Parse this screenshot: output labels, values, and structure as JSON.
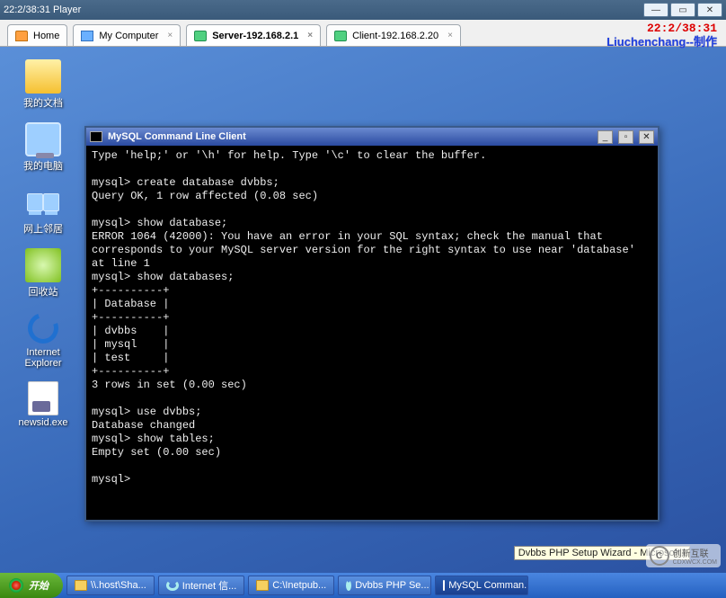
{
  "player": {
    "title": "22:2/38:31 Player"
  },
  "browser_tabs": {
    "items": [
      {
        "label": "Home"
      },
      {
        "label": "My Computer"
      },
      {
        "label": "Server-192.168.2.1"
      },
      {
        "label": "Client-192.168.2.20"
      }
    ],
    "active_index": 2,
    "clock": "22:2/38:31",
    "author": "Liuchenchang--制作"
  },
  "desktop_icons": [
    {
      "label": "我的文档"
    },
    {
      "label": "我的电脑"
    },
    {
      "label": "网上邻居"
    },
    {
      "label": "回收站"
    },
    {
      "label": "Internet Explorer"
    },
    {
      "label": "newsid.exe"
    }
  ],
  "mysql_window": {
    "title": "MySQL Command Line Client",
    "content": "Type 'help;' or '\\h' for help. Type '\\c' to clear the buffer.\n\nmysql> create database dvbbs;\nQuery OK, 1 row affected (0.08 sec)\n\nmysql> show database;\nERROR 1064 (42000): You have an error in your SQL syntax; check the manual that corresponds to your MySQL server version for the right syntax to use near 'database' at line 1\nmysql> show databases;\n+----------+\n| Database |\n+----------+\n| dvbbs    |\n| mysql    |\n| test     |\n+----------+\n3 rows in set (0.00 sec)\n\nmysql> use dvbbs;\nDatabase changed\nmysql> show tables;\nEmpty set (0.00 sec)\n\nmysql>"
  },
  "tooltip": "Dvbbs PHP Setup Wizard - Microsoft I",
  "taskbar": {
    "start_label": "开始",
    "items": [
      {
        "label": "\\\\.host\\Sha..."
      },
      {
        "label": "Internet 信..."
      },
      {
        "label": "C:\\Inetpub..."
      },
      {
        "label": "Dvbbs PHP Se..."
      },
      {
        "label": "MySQL Comman..."
      }
    ],
    "active_index": 4
  },
  "watermark": {
    "brand": "创新互联",
    "sub": "CDXWCX.COM"
  }
}
